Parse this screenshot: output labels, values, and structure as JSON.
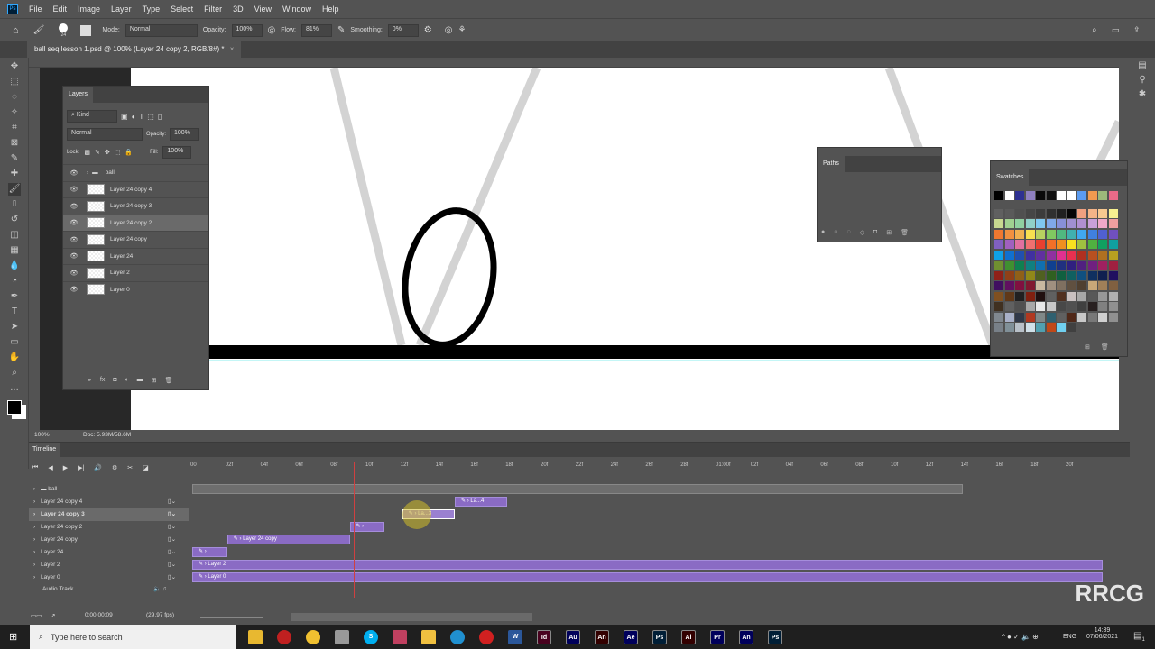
{
  "menu": [
    "File",
    "Edit",
    "Image",
    "Layer",
    "Type",
    "Select",
    "Filter",
    "3D",
    "View",
    "Window",
    "Help"
  ],
  "options": {
    "brush_size": "24",
    "mode_label": "Mode:",
    "mode": "Normal",
    "opacity_label": "Opacity:",
    "opacity": "100%",
    "flow_label": "Flow:",
    "flow": "81%",
    "smoothing_label": "Smoothing:",
    "smoothing": "0%"
  },
  "document_tab": "ball seq lesson 1.psd @ 100% (Layer 24 copy 2, RGB/8#) *",
  "status": {
    "zoom": "100%",
    "doc": "Doc: 5.93M/58.6M"
  },
  "layers_panel": {
    "title": "Layers",
    "kind": "Kind",
    "blend": "Normal",
    "opacity_label": "Opacity:",
    "opacity": "100%",
    "lock_label": "Lock:",
    "fill_label": "Fill:",
    "fill": "100%",
    "layers": [
      {
        "name": "ball",
        "group": true
      },
      {
        "name": "Layer 24 copy 4"
      },
      {
        "name": "Layer 24 copy 3"
      },
      {
        "name": "Layer 24 copy 2",
        "selected": true
      },
      {
        "name": "Layer 24 copy"
      },
      {
        "name": "Layer 24"
      },
      {
        "name": "Layer 2"
      },
      {
        "name": "Layer 0"
      }
    ]
  },
  "paths_panel": {
    "title": "Paths"
  },
  "swatches_panel": {
    "title": "Swatches",
    "colors": [
      "#000000",
      "#ffffff",
      "#2e3192",
      "#8f80c0",
      "#0a0a0a",
      "#111111",
      "#ffffff",
      "#ffffff",
      "#5b9bf0",
      "#f09a50",
      "#9cb87a",
      "#e86a88",
      "#606060",
      "#5a5a5a",
      "#505050",
      "#464646",
      "#3c3c3c",
      "#303030",
      "#202020",
      "#050505",
      "#f0a080",
      "#f4b488",
      "#f8c890",
      "#f8f090",
      "#c8d890",
      "#a0d090",
      "#90d0a0",
      "#90d0c8",
      "#80c8f0",
      "#80a8e8",
      "#8890d8",
      "#a090d0",
      "#b090d0",
      "#c8a0d8",
      "#f0a8c8",
      "#f0a0a0",
      "#f07830",
      "#f09040",
      "#f0b050",
      "#f8e050",
      "#b8d060",
      "#80c860",
      "#50b880",
      "#40b0b0",
      "#40a8f0",
      "#4080e0",
      "#5060d0",
      "#7050c0",
      "#8060c0",
      "#a060c0",
      "#e070a0",
      "#f07070",
      "#e84030",
      "#f07028",
      "#f09020",
      "#f8e020",
      "#a0c040",
      "#50b040",
      "#10a060",
      "#10a0a0",
      "#10a0e8",
      "#1070d0",
      "#2050b0",
      "#4030a0",
      "#6030a0",
      "#9030a0",
      "#e03090",
      "#e83050",
      "#b03020",
      "#b85020",
      "#b07020",
      "#b8a020",
      "#709030",
      "#409030",
      "#108050",
      "#108080",
      "#1070b0",
      "#104090",
      "#203080",
      "#302080",
      "#502080",
      "#702080",
      "#a02060",
      "#a02040",
      "#902018",
      "#904018",
      "#906018",
      "#908818",
      "#506020",
      "#306020",
      "#106040",
      "#106060",
      "#105080",
      "#103060",
      "#102050",
      "#201060",
      "#401060",
      "#601060",
      "#801040",
      "#801830",
      "#c8b8a0",
      "#a09080",
      "#807060",
      "#605040",
      "#504030",
      "#c8a878",
      "#a08058",
      "#806040",
      "#805020",
      "#603818",
      "#202020",
      "#802010",
      "#201010",
      "#606060",
      "#503020",
      "#c8c0c0",
      "#a8a8a8",
      "#585858",
      "#989898",
      "#b0b0b0",
      "#403020",
      "#606060",
      "#505050",
      "#a8a8a8",
      "#e8e8e8",
      "#c8c8c8",
      "#484848",
      "#505050",
      "#404040",
      "#282020",
      "#808080",
      "#909090",
      "#808890",
      "#a8b0c8",
      "#303848",
      "#b03820",
      "#808888",
      "#306070",
      "#606060",
      "#502818",
      "#c8c8c8",
      "#787878",
      "#d0d0d0",
      "#909090",
      "#788088",
      "#809098",
      "#b8c0c8",
      "#d0e0e8",
      "#50a0b0",
      "#c04818",
      "#70d0f0",
      "#404040"
    ]
  },
  "timeline": {
    "title": "Timeline",
    "timecode": "0;00;00;09",
    "fps": "(29.97 fps)",
    "current_frame": 9,
    "ticks": [
      "00",
      "02f",
      "04f",
      "06f",
      "08f",
      "10f",
      "12f",
      "14f",
      "16f",
      "18f",
      "20f",
      "22f",
      "24f",
      "26f",
      "28f",
      "01:00f",
      "02f",
      "04f",
      "06f",
      "08f",
      "10f",
      "12f",
      "14f",
      "16f",
      "18f",
      "20f"
    ],
    "tracks": [
      {
        "name": "ball",
        "group": true,
        "clip": {
          "start": 0,
          "end": 44,
          "label": ""
        }
      },
      {
        "name": "Layer 24 copy 4",
        "clip": {
          "start": 15,
          "end": 18,
          "label": "La...4"
        }
      },
      {
        "name": "Layer 24 copy 3",
        "selected": true,
        "clip": {
          "start": 12,
          "end": 15,
          "label": "La...3"
        }
      },
      {
        "name": "Layer 24 copy 2",
        "clip": {
          "start": 9,
          "end": 11,
          "label": ""
        }
      },
      {
        "name": "Layer 24 copy",
        "clip": {
          "start": 2,
          "end": 9,
          "label": "Layer 24 copy"
        }
      },
      {
        "name": "Layer 24",
        "clip": {
          "start": 0,
          "end": 2,
          "label": ""
        }
      },
      {
        "name": "Layer 2",
        "clip": {
          "start": 0,
          "end": 52,
          "label": "Layer 2"
        }
      },
      {
        "name": "Layer 0",
        "clip": {
          "start": 0,
          "end": 52,
          "label": "Layer 0"
        }
      }
    ],
    "audio_track": "Audio Track"
  },
  "taskbar": {
    "search_placeholder": "Type here to search",
    "lang": "ENG",
    "time": "14:39",
    "date": "07/06/2021",
    "notifications": "1",
    "apps": [
      {
        "label": "Id",
        "color": "#49021f"
      },
      {
        "label": "Au",
        "color": "#00005b"
      },
      {
        "label": "An",
        "color": "#330000"
      },
      {
        "label": "Ae",
        "color": "#00005b"
      },
      {
        "label": "Ps",
        "color": "#001e36"
      },
      {
        "label": "Ai",
        "color": "#330000"
      },
      {
        "label": "Pr",
        "color": "#00005b"
      },
      {
        "label": "An",
        "color": "#00005b"
      },
      {
        "label": "Ps",
        "color": "#001e36"
      }
    ]
  },
  "watermark": "RRCG 人人素材"
}
